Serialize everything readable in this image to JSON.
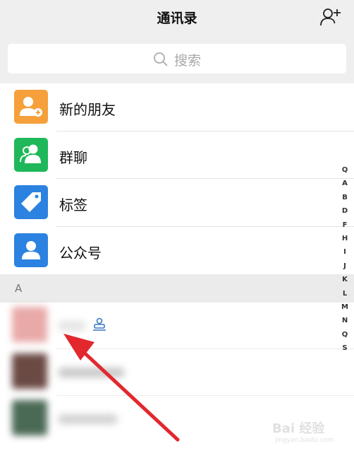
{
  "header": {
    "title": "通讯录",
    "add_friend_icon": "person-plus-icon"
  },
  "search": {
    "placeholder": "搜索",
    "icon": "search-icon"
  },
  "menu_items": [
    {
      "label": "新的朋友",
      "icon": "new-friend-icon",
      "color": "#f5a03b"
    },
    {
      "label": "群聊",
      "icon": "group-chat-icon",
      "color": "#1eb85a"
    },
    {
      "label": "标签",
      "icon": "tag-icon",
      "color": "#2b82e0"
    },
    {
      "label": "公众号",
      "icon": "official-account-icon",
      "color": "#2b82e0"
    }
  ],
  "section": {
    "letter": "A"
  },
  "contacts": [
    {
      "name": "",
      "avatar_color": "#e9a9a9",
      "name_color": "#e4e4e4",
      "badge_icon": "enterprise-contact-icon"
    },
    {
      "name": "",
      "avatar_color": "#6b4a44",
      "name_color": "#c9c9c9"
    },
    {
      "name": "",
      "avatar_color": "#4b6a56",
      "name_color": "#d2d2d2"
    }
  ],
  "index_letters": [
    "Q",
    "A",
    "B",
    "D",
    "F",
    "H",
    "I",
    "J",
    "K",
    "L",
    "M",
    "N",
    "Q",
    "S"
  ],
  "annotation": {
    "arrow_color": "#e2282d"
  },
  "watermark": {
    "main": "Bai 经验",
    "sub": "jingyan.baidu.com"
  }
}
